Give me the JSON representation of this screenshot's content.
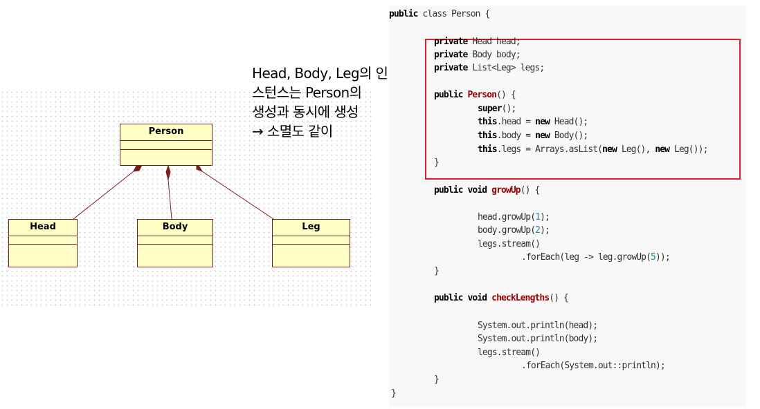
{
  "diagram": {
    "classes": [
      {
        "id": "person",
        "name": "Person"
      },
      {
        "id": "head",
        "name": "Head"
      },
      {
        "id": "body",
        "name": "Body"
      },
      {
        "id": "leg",
        "name": "Leg"
      }
    ],
    "relations": [
      {
        "from": "person",
        "to": "head",
        "type": "composition"
      },
      {
        "from": "person",
        "to": "body",
        "type": "composition"
      },
      {
        "from": "person",
        "to": "leg",
        "type": "composition"
      }
    ],
    "colors": {
      "class_fill": "#ffffc6",
      "class_border": "#7a1f1f",
      "relation_line": "#7a1f1f",
      "highlight": "#e0202a"
    }
  },
  "annotation": {
    "lines": [
      "Head, Body, Leg의 인",
      "스턴스는 Person의",
      "생성과 동시에 생성",
      "→ 소멸도 같이"
    ]
  },
  "code": {
    "lines": [
      [
        {
          "t": "public",
          "s": "kw"
        },
        {
          "t": " class Person {"
        }
      ],
      [
        {
          "t": "private",
          "s": "kw"
        },
        {
          "t": " Head head;"
        }
      ],
      [
        {
          "t": "private",
          "s": "kw"
        },
        {
          "t": " Body body;"
        }
      ],
      [
        {
          "t": "private",
          "s": "kw"
        },
        {
          "t": " List<Leg> legs;"
        }
      ],
      [
        {
          "t": "public",
          "s": "kw"
        },
        {
          "t": " "
        },
        {
          "t": "Person",
          "s": "fn"
        },
        {
          "t": "() {"
        }
      ],
      [
        {
          "t": "super",
          "s": "kw"
        },
        {
          "t": "();"
        }
      ],
      [
        {
          "t": "this",
          "s": "kw"
        },
        {
          "t": ".head = "
        },
        {
          "t": "new",
          "s": "kw"
        },
        {
          "t": " Head();"
        }
      ],
      [
        {
          "t": "this",
          "s": "kw"
        },
        {
          "t": ".body = "
        },
        {
          "t": "new",
          "s": "kw"
        },
        {
          "t": " Body();"
        }
      ],
      [
        {
          "t": "this",
          "s": "kw"
        },
        {
          "t": ".legs = Arrays.asList("
        },
        {
          "t": "new",
          "s": "kw"
        },
        {
          "t": " Leg(), "
        },
        {
          "t": "new",
          "s": "kw"
        },
        {
          "t": " Leg());"
        }
      ],
      [
        {
          "t": "}"
        }
      ],
      [
        {
          "t": "public",
          "s": "kw"
        },
        {
          "t": " "
        },
        {
          "t": "void",
          "s": "kw"
        },
        {
          "t": " "
        },
        {
          "t": "growUp",
          "s": "fn"
        },
        {
          "t": "() {"
        }
      ],
      [
        {
          "t": "head.growUp("
        },
        {
          "t": "1",
          "s": "num"
        },
        {
          "t": ");"
        }
      ],
      [
        {
          "t": "body.growUp("
        },
        {
          "t": "2",
          "s": "num"
        },
        {
          "t": ");"
        }
      ],
      [
        {
          "t": "legs.stream()"
        }
      ],
      [
        {
          "t": ".forEach(leg -> leg.growUp("
        },
        {
          "t": "5",
          "s": "num"
        },
        {
          "t": "));"
        }
      ],
      [
        {
          "t": "}"
        }
      ],
      [
        {
          "t": "public",
          "s": "kw"
        },
        {
          "t": " "
        },
        {
          "t": "void",
          "s": "kw"
        },
        {
          "t": " "
        },
        {
          "t": "checkLengths",
          "s": "fn"
        },
        {
          "t": "() {"
        }
      ],
      [
        {
          "t": "System.out.println(head);"
        }
      ],
      [
        {
          "t": "System.out.println(body);"
        }
      ],
      [
        {
          "t": "legs.stream()"
        }
      ],
      [
        {
          "t": ".forEach(System.out::println);"
        }
      ],
      [
        {
          "t": "}"
        }
      ],
      [
        {
          "t": "}"
        }
      ]
    ]
  }
}
